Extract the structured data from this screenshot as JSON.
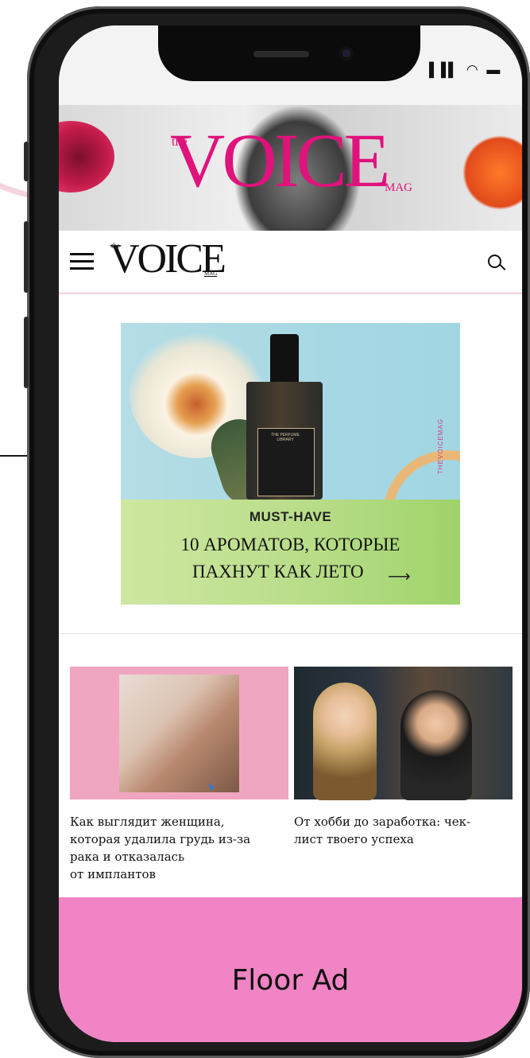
{
  "status_bar": {
    "icons": "▐▐▌ ◠ ▬"
  },
  "banner": {
    "brand_prefix": "the",
    "brand": "VOICE",
    "brand_suffix": "MAG"
  },
  "header": {
    "logo_prefix": "the",
    "logo": "VOICE",
    "logo_suffix": "MAG",
    "menu_icon": "hamburger-menu-icon",
    "search_icon": "search-icon"
  },
  "ad": {
    "bottle_brand": "THE PERFUME LIBRARY",
    "vertical_text": "THEVOICEMAG",
    "kicker": "MUST-HAVE",
    "line1": "10 АРОМАТОВ, КОТОРЫЕ",
    "line2": "ПАХНУТ КАК ЛЕТО",
    "arrow": "⟶"
  },
  "articles": [
    {
      "title_lines": [
        "Как выглядит женщина,",
        "которая удалила грудь из-за",
        "рака и отказалась",
        "от имплантов"
      ]
    },
    {
      "title_lines": [
        "От хобби до заработка: чек-",
        "лист твоего успеха"
      ]
    }
  ],
  "floor_ad": {
    "label": "Floor Ad",
    "color": "#f084c4"
  },
  "colors": {
    "brand_pink": "#e0127c",
    "accent_line": "#f0a4c8"
  }
}
